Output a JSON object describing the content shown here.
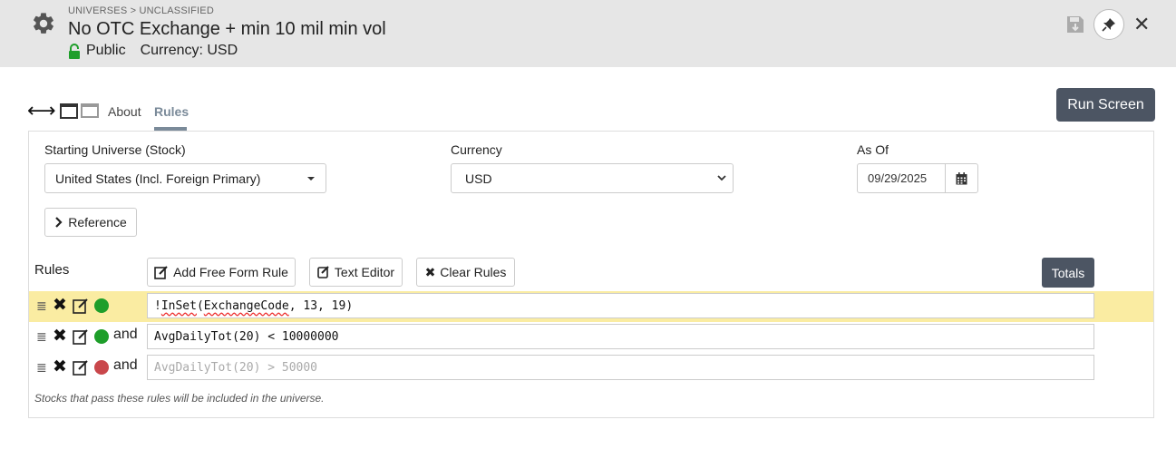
{
  "header": {
    "breadcrumb": "UNIVERSES > UNCLASSIFIED",
    "title": "No OTC Exchange + min 10 mil min vol",
    "visibility": "Public",
    "currency": "Currency: USD",
    "icons": [
      "gear-icon",
      "lock-icon",
      "save-icon",
      "pin-icon",
      "close-icon"
    ]
  },
  "tabs": [
    {
      "label": "About",
      "active": false
    },
    {
      "label": "Rules",
      "active": true
    }
  ],
  "run_screen_label": "Run Screen",
  "form": {
    "starting_universe": {
      "label": "Starting Universe (Stock)",
      "value": "United States (Incl. Foreign Primary)"
    },
    "currency": {
      "label": "Currency",
      "value": "USD"
    },
    "as_of": {
      "label": "As Of",
      "value": "09/29/2025"
    },
    "reference_label": "Reference"
  },
  "rules_section": {
    "label": "Rules",
    "add_free_form_label": "Add Free Form Rule",
    "text_editor_label": "Text Editor",
    "clear_rules_label": "Clear Rules",
    "totals_label": "Totals"
  },
  "rules": [
    {
      "connector": "",
      "enabled": true,
      "highlighted": true,
      "prefix": "!",
      "token": "InSet",
      "mid": "(",
      "token2": "ExchangeCode",
      "suffix": ", 13, 19)"
    },
    {
      "connector": "and",
      "enabled": true,
      "highlighted": false,
      "text": "AvgDailyTot(20) < 10000000"
    },
    {
      "connector": "and",
      "enabled": false,
      "highlighted": false,
      "text": "AvgDailyTot(20) > 50000"
    }
  ],
  "footer_note": "Stocks that pass these rules will be included in the universe.",
  "colors": {
    "accent_dark": "#4c5563",
    "tab_active": "#7a8a99",
    "rule_enabled": "#1e9e2a",
    "rule_disabled": "#c9474b",
    "row_highlight": "#faeca2",
    "lock_green": "#1e9e2a"
  }
}
